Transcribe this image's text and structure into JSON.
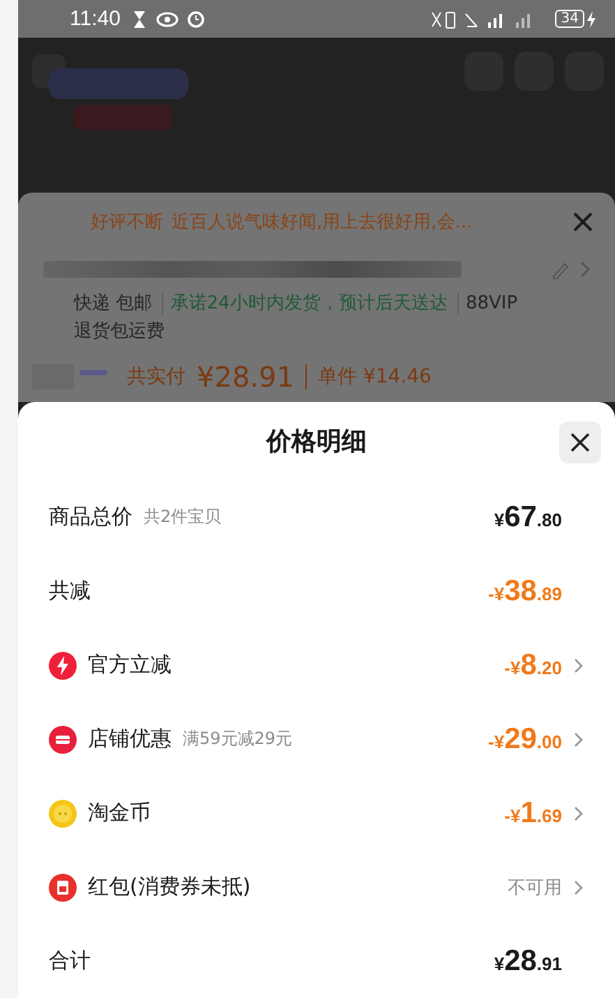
{
  "status_bar": {
    "time": "11:40",
    "battery": "34"
  },
  "background_page": {
    "review_tag": "好评不断",
    "review_text": "近百人说气味好闻,用上去很好用,会...",
    "shipping": "快递 包邮",
    "promise": "承诺24小时内发货，预计后天送达",
    "vip": "88VIP退货包运费",
    "pay_label": "共实付",
    "pay_price": "¥28.91",
    "unit_price": "单件 ¥14.46"
  },
  "sheet": {
    "title": "价格明细",
    "rows": [
      {
        "label": "商品总价",
        "note": "共2件宝贝",
        "kind": "summary",
        "price": {
          "prefix": "¥",
          "main": "67",
          "cents": ".80"
        },
        "link": false
      },
      {
        "label": "共减",
        "kind": "deduction",
        "price": {
          "prefix": "-¥",
          "main": "38",
          "cents": ".89"
        },
        "link": false
      },
      {
        "label": "官方立减",
        "kind": "deduction",
        "price": {
          "prefix": "-¥",
          "main": "8",
          "cents": ".20"
        },
        "link": true
      },
      {
        "label": "店铺优惠",
        "note": "满59元减29元",
        "kind": "deduction",
        "price": {
          "prefix": "-¥",
          "main": "29",
          "cents": ".00"
        },
        "link": true
      },
      {
        "label": "淘金币",
        "kind": "deduction",
        "price": {
          "prefix": "-¥",
          "main": "1",
          "cents": ".69"
        },
        "link": true
      },
      {
        "label": "红包(消费券未抵)",
        "kind": "status",
        "status": "不可用",
        "link": true
      },
      {
        "label": "合计",
        "kind": "summary",
        "price": {
          "prefix": "¥",
          "main": "28",
          "cents": ".91"
        },
        "link": false
      }
    ]
  }
}
